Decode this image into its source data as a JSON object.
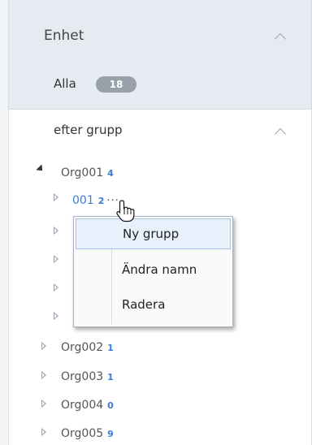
{
  "header": {
    "title": "Enhet",
    "all_label": "Alla",
    "all_count": "18"
  },
  "group": {
    "title": "efter grupp"
  },
  "tree": {
    "org001": {
      "label": "Org001",
      "count": "4"
    },
    "item001": {
      "label": "001",
      "count": "2",
      "more": "···"
    },
    "org002": {
      "label": "Org002",
      "count": "1"
    },
    "org003": {
      "label": "Org003",
      "count": "1"
    },
    "org004": {
      "label": "Org004",
      "count": "0"
    },
    "org005": {
      "label": "Org005",
      "count": "9"
    }
  },
  "context_menu": {
    "items": [
      "Ny grupp",
      "Ändra namn",
      "Radera"
    ]
  },
  "colors": {
    "accent": "#3a7bd5",
    "header_bg": "#e6ebf1",
    "badge_bg": "#98a1ab",
    "menu_hover": "#e8f1fb"
  }
}
